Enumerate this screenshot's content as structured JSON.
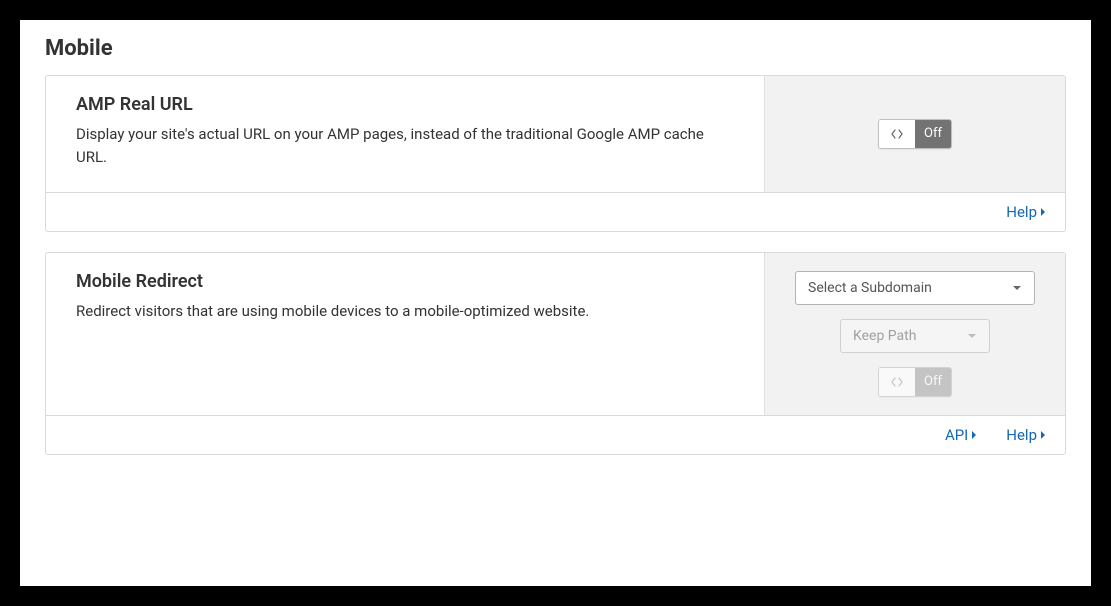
{
  "page": {
    "title": "Mobile"
  },
  "amp": {
    "title": "AMP Real URL",
    "desc": "Display your site's actual URL on your AMP pages, instead of the traditional Google AMP cache URL.",
    "toggle_state": "Off",
    "help_label": "Help"
  },
  "redirect": {
    "title": "Mobile Redirect",
    "desc": "Redirect visitors that are using mobile devices to a mobile-optimized website.",
    "subdomain_placeholder": "Select a Subdomain",
    "keep_path_label": "Keep Path",
    "toggle_state": "Off",
    "api_label": "API",
    "help_label": "Help"
  }
}
